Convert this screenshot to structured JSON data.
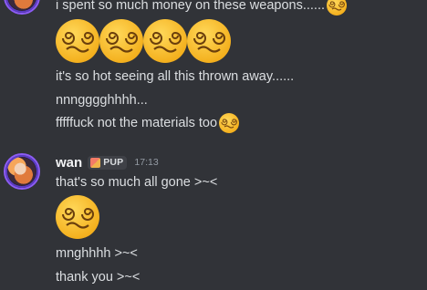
{
  "messages_top": {
    "line_0": "i spent so much money on these weapons......",
    "line_1": "it's so hot seeing all this thrown away......",
    "line_2": "nnngggghhhh...",
    "line_3": "fffffuck not the materials too",
    "emoji_name": "dizzy-face-emoji"
  },
  "message_wan": {
    "username": "wan",
    "tag": "PUP",
    "timestamp": "17:13",
    "line_0": "that's so much all gone >~<",
    "line_1": "mnghhhh >~<",
    "line_2": "thank you >~<"
  },
  "colors": {
    "background": "#313338",
    "text": "#dbdee1",
    "username": "#f2f3f5",
    "timestamp": "#949ba4",
    "avatar_ring": "#8c5cf5"
  }
}
